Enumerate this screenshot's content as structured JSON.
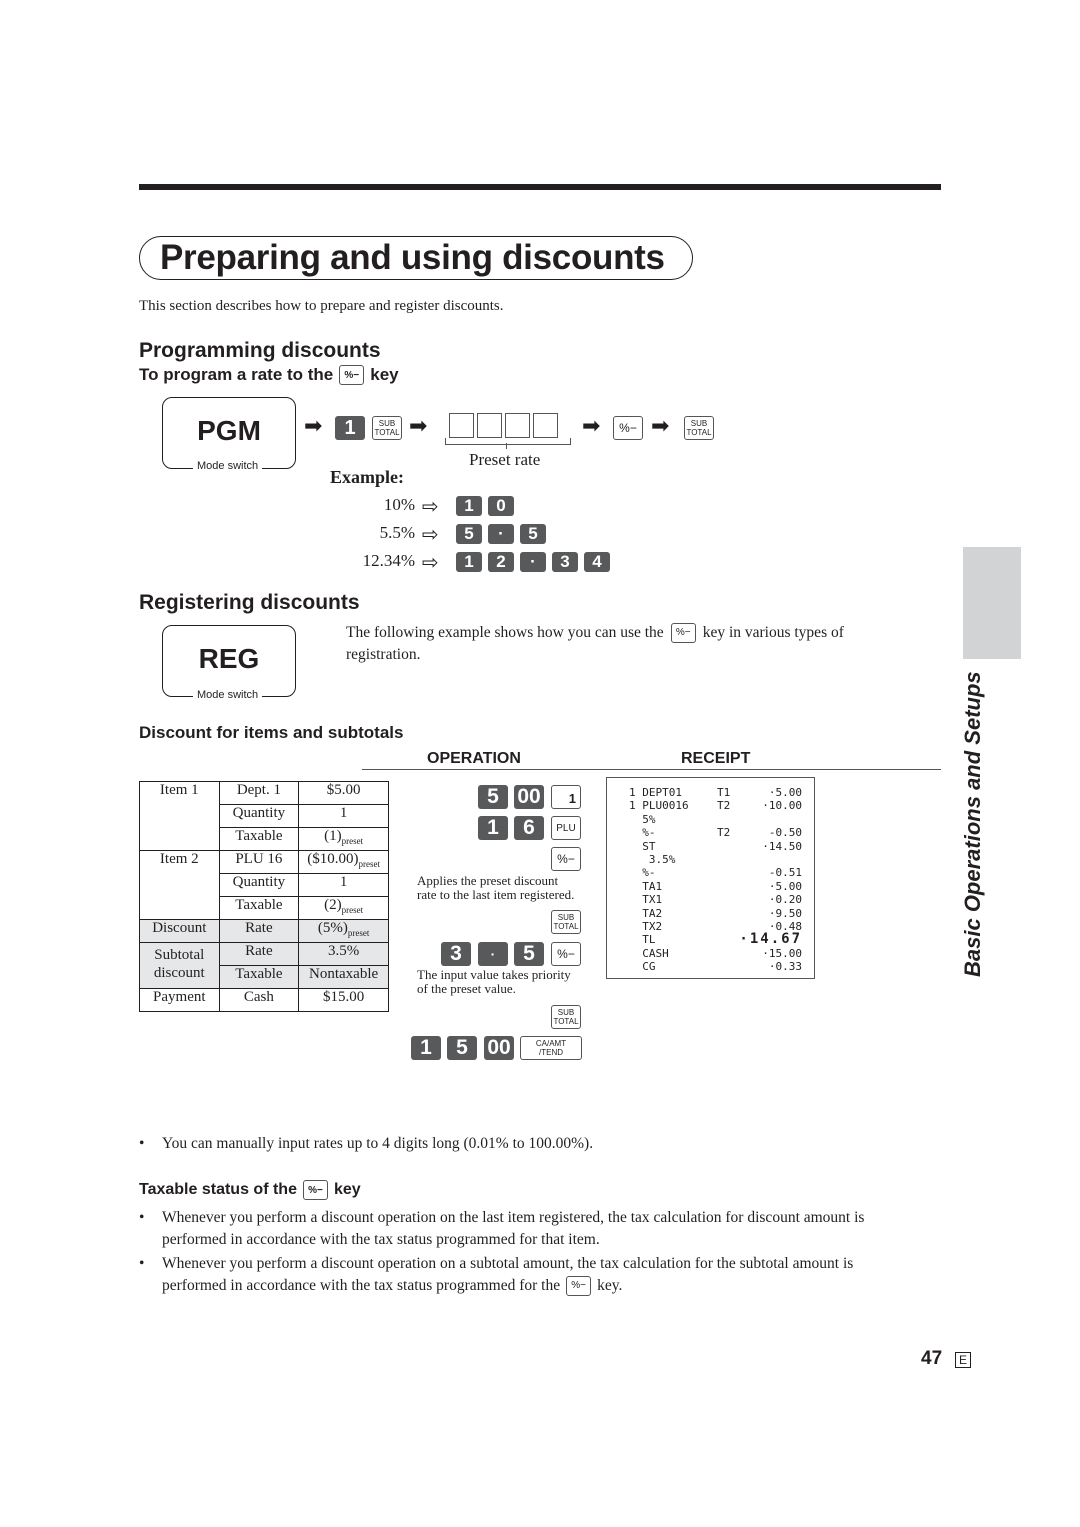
{
  "page": {
    "title": "Preparing and using discounts",
    "intro": "This section describes how to prepare and register discounts.",
    "side_tab_label": "Basic Operations and Setups",
    "page_number": "47",
    "page_lang": "E"
  },
  "programming": {
    "heading": "Programming discounts",
    "subheading_prefix": "To program a rate to the",
    "subheading_suffix": "key",
    "mode_label": "PGM",
    "mode_caption": "Mode switch",
    "sequence_key_1": "1",
    "subtotal_key_line1": "SUB",
    "subtotal_key_line2": "TOTAL",
    "pct_key": "%−",
    "preset_rate_label": "Preset rate",
    "example_label": "Example:",
    "examples": [
      {
        "rate": "10%",
        "keys": [
          "1",
          "0"
        ]
      },
      {
        "rate": "5.5%",
        "keys": [
          "5",
          "·",
          "5"
        ]
      },
      {
        "rate": "12.34%",
        "keys": [
          "1",
          "2",
          "·",
          "3",
          "4"
        ]
      }
    ]
  },
  "registering": {
    "heading": "Registering discounts",
    "mode_label": "REG",
    "mode_caption": "Mode switch",
    "desc_prefix": "The following example shows how you can use the",
    "desc_suffix": "key in various types of",
    "desc_line2": "registration.",
    "subheading": "Discount for items and subtotals",
    "operation_header": "OPERATION",
    "receipt_header": "RECEIPT"
  },
  "spec_table": {
    "rows": [
      {
        "group": "Item 1",
        "label": "Dept. 1",
        "value": "$5.00",
        "sub": ""
      },
      {
        "group": "",
        "label": "Quantity",
        "value": "1",
        "sub": ""
      },
      {
        "group": "",
        "label": "Taxable",
        "value": "(1)",
        "sub": "preset"
      },
      {
        "group": "Item 2",
        "label": "PLU 16",
        "value": "($10.00)",
        "sub": "preset"
      },
      {
        "group": "",
        "label": "Quantity",
        "value": "1",
        "sub": ""
      },
      {
        "group": "",
        "label": "Taxable",
        "value": "(2)",
        "sub": "preset"
      },
      {
        "group": "Discount",
        "label": "Rate",
        "value": "(5%)",
        "sub": "preset"
      },
      {
        "group": "Subtotal discount",
        "label": "Rate",
        "value": "3.5%",
        "sub": ""
      },
      {
        "group": "",
        "label": "Taxable",
        "value": "Nontaxable",
        "sub": ""
      },
      {
        "group": "Payment",
        "label": "Cash",
        "value": "$15.00",
        "sub": ""
      }
    ],
    "group_1": "Item 1",
    "group_2": "Item 2",
    "group_3": "Discount",
    "group_4_line1": "Subtotal",
    "group_4_line2": "discount",
    "group_5": "Payment"
  },
  "operation": {
    "step1_keys": [
      "5",
      "00"
    ],
    "dept_key": "1",
    "step2_keys": [
      "1",
      "6"
    ],
    "plu_key": "PLU",
    "pct_key": "%−",
    "note1_line1": "Applies the preset discount",
    "note1_line2": "rate to the last item registered.",
    "subtotal_key_line1": "SUB",
    "subtotal_key_line2": "TOTAL",
    "step3_keys": [
      "3",
      "·",
      "5"
    ],
    "note2_line1": "The input value takes priority",
    "note2_line2": "of the preset value.",
    "step4_keys": [
      "1",
      "5",
      "00"
    ],
    "tend_key_line1": "CA/AMT",
    "tend_key_line2": "/TEND"
  },
  "receipt": {
    "lines": [
      {
        "c1": "1 DEPT01",
        "c2": "T1",
        "c3": "·5.00"
      },
      {
        "c1": "1 PLU0016",
        "c2": "T2",
        "c3": "·10.00"
      },
      {
        "c1": "  5%",
        "c2": "",
        "c3": ""
      },
      {
        "c1": "  %-",
        "c2": "T2",
        "c3": "-0.50"
      },
      {
        "c1": "  ST",
        "c2": "",
        "c3": "·14.50"
      },
      {
        "c1": "   3.5%",
        "c2": "",
        "c3": ""
      },
      {
        "c1": "  %-",
        "c2": "",
        "c3": "-0.51"
      },
      {
        "c1": "  TA1",
        "c2": "",
        "c3": "·5.00"
      },
      {
        "c1": "  TX1",
        "c2": "",
        "c3": "·0.20"
      },
      {
        "c1": "  TA2",
        "c2": "",
        "c3": "·9.50"
      },
      {
        "c1": "  TX2",
        "c2": "",
        "c3": "·0.48"
      },
      {
        "c1": "  TL",
        "c2": "",
        "c3": "·14.67"
      },
      {
        "c1": "  CASH",
        "c2": "",
        "c3": "·15.00"
      },
      {
        "c1": "  CG",
        "c2": "",
        "c3": "·0.33"
      }
    ]
  },
  "notes": {
    "bullet_rates": "You can manually input rates up to 4 digits long (0.01% to 100.00%).",
    "taxable_heading_prefix": "Taxable status of the",
    "taxable_heading_suffix": "key",
    "bullet_1_line1": "Whenever you perform a discount operation on the last item registered, the tax calculation for discount amount is",
    "bullet_1_line2": "performed in accordance with the tax status programmed for that item.",
    "bullet_2_line1": "Whenever you perform a discount operation on a subtotal amount, the tax calculation for the subtotal amount is",
    "bullet_2_line2_prefix": "performed in accordance with the tax status programmed for the",
    "bullet_2_line2_suffix": "key.",
    "bullet_symbol": "•",
    "pct_key": "%−"
  }
}
